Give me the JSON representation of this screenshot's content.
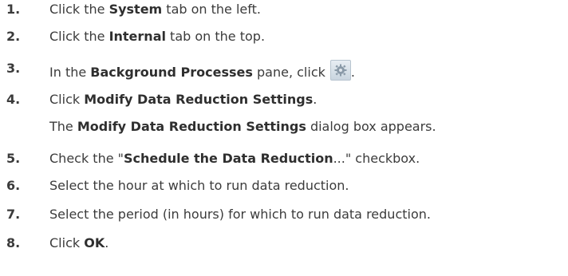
{
  "steps": [
    {
      "number": "1.",
      "pre": "Click the ",
      "bold": "System",
      "post": " tab on the left."
    },
    {
      "number": "2.",
      "pre": "Click the ",
      "bold": "Internal",
      "post": " tab on the top."
    },
    {
      "number": "3.",
      "pre": "In the ",
      "bold": "Background Processes",
      "post": " pane, click",
      "tail": ".",
      "icon": "gear-icon"
    },
    {
      "number": "4.",
      "pre": "Click ",
      "bold": "Modify Data Reduction Settings",
      "post": ".",
      "sub_bold": "Modify Data Reduction Settings",
      "sub_pre": "The ",
      "sub_post": " dialog box appears."
    },
    {
      "number": "5.",
      "pre": "Check the \"",
      "bold": "Schedule the Data Reduction",
      "post": "...\" checkbox."
    },
    {
      "number": "6.",
      "text": "Select the hour at which to run data reduction."
    },
    {
      "number": "7.",
      "text": "Select the period (in hours) for which to run data reduction."
    },
    {
      "number": "8.",
      "pre": "Click ",
      "bold": "OK",
      "post": "."
    }
  ]
}
